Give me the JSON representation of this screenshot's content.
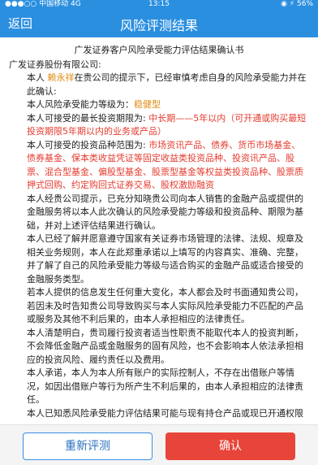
{
  "status_bar": {
    "carrier": "●●●○○ 中国移动  4G",
    "time": "13:15",
    "battery": "◉ ⚡ 56%"
  },
  "nav": {
    "back_label": "返回",
    "title": "风险评测结果"
  },
  "document": {
    "title": "广发证券客户风险承受能力评估结果确认书",
    "addressee": "广发证券股份有限公司:",
    "p1_a": "本人 ",
    "p1_name": "赖永祥",
    "p1_b": "在贵公司的提示下，已经审慎考虑自身的风险承受能力并在此确认:",
    "level_label": "本人风险承受能力等级为：",
    "level_value": "稳健型",
    "term_label": "本人可接受的最长投资期限为: ",
    "term_value": "中长期——5年以内（可开通或购买最短投资期限5年期以内的业务或产品）",
    "scope_label": "本人可接受的投资品种范围为: ",
    "scope_value": "市场资讯产品、债券、货币市场基金、债券基金、保本类收益凭证等固定收益类投资品种、投资讯产品、股票、混合型基金、偏股型基金、股票型基金等权益类投资品种、股票质押式回购、约定购回式证券交易、股权激励融资",
    "p2": "本人经贵公司提示，已充分知晓贵公司向本人销售的金融产品或提供的金融服务将以本人此次确认的风险承受能力等级和投资品种、期限为基础，并对上述评估结果进行确认。",
    "p3": "本人已经了解并愿意遵守国家有关证券市场管理的法律、法规、规章及相关业务规则，本人在此郑重承诺以上填写的内容真实、准确、完整，并了解了自己的风险承受能力等级与适合购买的金融产品或适合接受的金融服务类型。",
    "p4": "若本人提供的信息发生任何重大变化，本人都会及时书面通知贵公司，若因未及时告知贵公司导致购买与本人实际风险承受能力不匹配的产品或服务及其他不利后果的，由本人承担相应的法律责任。",
    "p5": "本人清楚明白，贵司履行投资者适当性职责不能取代本人的投资判断，不会降低金融产品或金融服务的固有风险，也不会影响本人依法承担相应的投资风险、履约责任以及费用。",
    "p6": "本人承诺，本人为本人所有账户的实际控制人，不存在出借账户等情况，如因出借账户等行为所产生不利后果的，由本人承担相应的法律责任。",
    "p7": "本人已知悉风险承受能力评估结果可能与现有持仓产品或现已开通权限风险等级不匹配情况，并已充分了解相关风险。"
  },
  "footer": {
    "retest_label": "重新评测",
    "confirm_label": "确认"
  },
  "colors": {
    "primary": "#2b8fe0",
    "highlight_red": "#e53a2e",
    "highlight_orange": "#e08a10",
    "confirm": "#e8453a"
  }
}
